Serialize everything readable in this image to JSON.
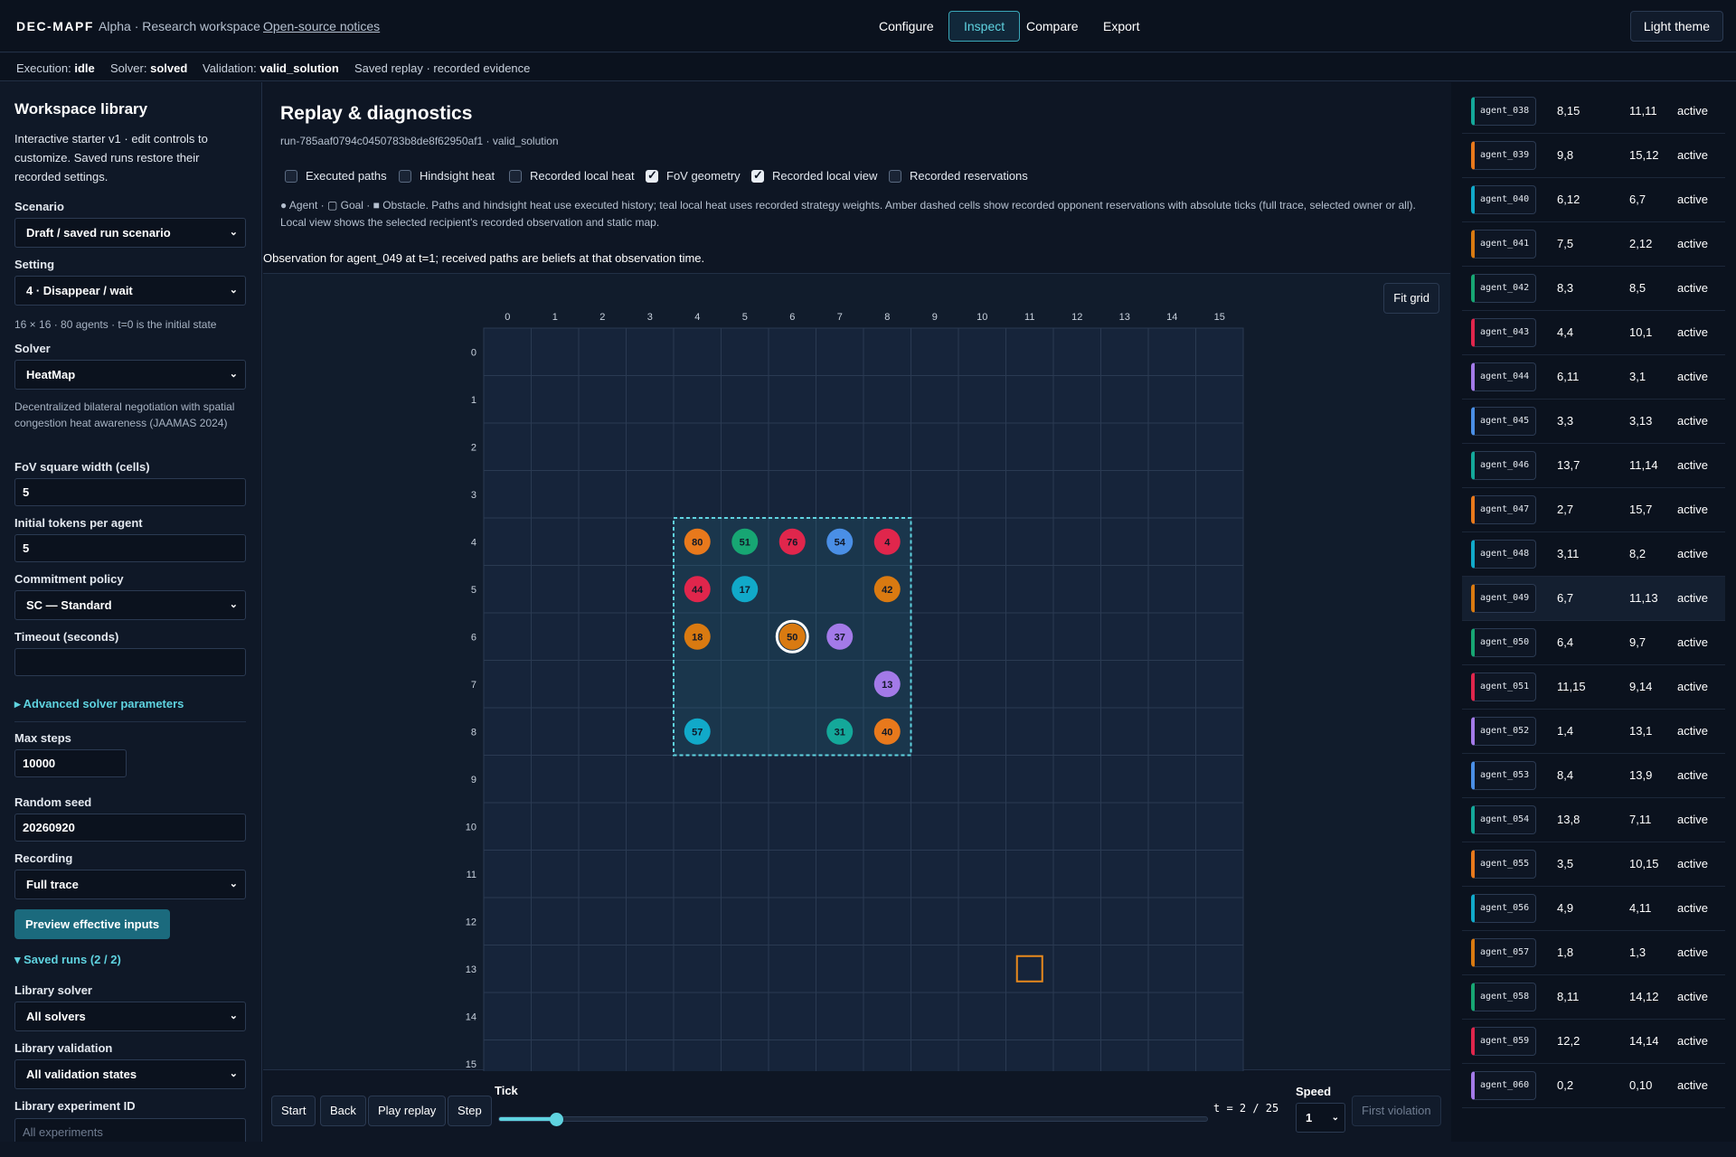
{
  "header": {
    "brand": "DEC-MAPF",
    "workspace": "Alpha · Research workspace",
    "notices_link": "Open-source notices",
    "nav": [
      {
        "label": "Configure"
      },
      {
        "label": "Inspect"
      },
      {
        "label": "Compare"
      },
      {
        "label": "Export"
      }
    ],
    "active_nav": "Inspect",
    "theme_button": "Light theme"
  },
  "status": {
    "execution_label": "Execution:",
    "execution_value": "idle",
    "solver_label": "Solver:",
    "solver_value": "solved",
    "validation_label": "Validation:",
    "validation_value": "valid_solution",
    "replay_note": "Saved replay · recorded evidence"
  },
  "sidebar": {
    "title": "Workspace library",
    "description": "Interactive starter v1 · edit controls to customize. Saved runs restore their recorded settings.",
    "scenario_label": "Scenario",
    "scenario_value": "Draft / saved run scenario",
    "setting_label": "Setting",
    "setting_value": "4 · Disappear / wait",
    "setting_hint": "16 × 16 · 80 agents · t=0 is the initial state",
    "solver_label": "Solver",
    "solver_value": "HeatMap",
    "solver_hint": "Decentralized bilateral negotiation with spatial congestion heat awareness (JAAMAS 2024)",
    "fov_label": "FoV square width (cells)",
    "fov_value": "5",
    "tokens_label": "Initial tokens per agent",
    "tokens_value": "5",
    "commitment_label": "Commitment policy",
    "commitment_value": "SC — Standard",
    "timeout_label": "Timeout (seconds)",
    "timeout_value": "",
    "advanced_label": "Advanced solver parameters",
    "max_steps_label": "Max steps",
    "max_steps_value": "10000",
    "seed_label": "Random seed",
    "seed_value": "20260920",
    "recording_label": "Recording",
    "recording_value": "Full trace",
    "preview_button": "Preview effective inputs",
    "saved_runs_label": "Saved runs (2 / 2)",
    "library_solver_label": "Library solver",
    "library_solver_value": "All solvers",
    "library_validation_label": "Library validation",
    "library_validation_value": "All validation states",
    "library_experiment_label": "Library experiment ID",
    "library_experiment_placeholder": "All experiments"
  },
  "main": {
    "title": "Replay & diagnostics",
    "run_id": "run-785aaf0794c0450783b8de8f62950af1 · valid_solution",
    "toggles": [
      {
        "label": "Executed paths",
        "checked": false
      },
      {
        "label": "Hindsight heat",
        "checked": false
      },
      {
        "label": "Recorded local heat",
        "checked": false
      },
      {
        "label": "FoV geometry",
        "checked": true
      },
      {
        "label": "Recorded local view",
        "checked": true
      },
      {
        "label": "Recorded reservations",
        "checked": false
      }
    ],
    "legend": "● Agent · ▢ Goal · ■ Obstacle. Paths and hindsight heat use executed history; teal local heat uses recorded strategy weights. Amber dashed cells show recorded opponent reservations with absolute ticks (full trace, selected owner or all). Local view shows the selected recipient's recorded observation and static map.",
    "observation": "Observation for agent_049 at t=1; received paths are beliefs at that observation time.",
    "fit_button": "Fit grid"
  },
  "grid": {
    "cols": 16,
    "rows": 16,
    "fov": {
      "col_start": 4,
      "row_start": 4,
      "size": 5
    },
    "selected_agent": "50",
    "agents": [
      {
        "id": "80",
        "x": 4,
        "y": 4,
        "color": "#e8791c"
      },
      {
        "id": "51",
        "x": 5,
        "y": 4,
        "color": "#17a673"
      },
      {
        "id": "76",
        "x": 6,
        "y": 4,
        "color": "#e0264c"
      },
      {
        "id": "54",
        "x": 7,
        "y": 4,
        "color": "#4a8fe6"
      },
      {
        "id": "4",
        "x": 8,
        "y": 4,
        "color": "#e0264c"
      },
      {
        "id": "44",
        "x": 4,
        "y": 5,
        "color": "#e0264c"
      },
      {
        "id": "17",
        "x": 5,
        "y": 5,
        "color": "#11a9c9"
      },
      {
        "id": "42",
        "x": 8,
        "y": 5,
        "color": "#d97a11"
      },
      {
        "id": "18",
        "x": 4,
        "y": 6,
        "color": "#d97a11"
      },
      {
        "id": "50",
        "x": 6,
        "y": 6,
        "color": "#d97a11"
      },
      {
        "id": "37",
        "x": 7,
        "y": 6,
        "color": "#a37ae8"
      },
      {
        "id": "13",
        "x": 8,
        "y": 7,
        "color": "#a37ae8"
      },
      {
        "id": "57",
        "x": 4,
        "y": 8,
        "color": "#11a9c9"
      },
      {
        "id": "31",
        "x": 7,
        "y": 8,
        "color": "#14a89a"
      },
      {
        "id": "40",
        "x": 8,
        "y": 8,
        "color": "#e8791c"
      }
    ],
    "goal": {
      "x": 11,
      "y": 13,
      "color": "#e8891c"
    }
  },
  "playback": {
    "start": "Start",
    "back": "Back",
    "play": "Play replay",
    "step": "Step",
    "tick_label": "Tick",
    "tick_readout": "t = 2 / 25",
    "tick": 2,
    "tick_max": 25,
    "speed_label": "Speed",
    "speed_value": "1",
    "first_violation": "First violation"
  },
  "agent_table": [
    {
      "name": "agent_038",
      "pos": "8,15",
      "goal": "11,11",
      "status": "active",
      "color": "#14a89a"
    },
    {
      "name": "agent_039",
      "pos": "9,8",
      "goal": "15,12",
      "status": "active",
      "color": "#e8791c"
    },
    {
      "name": "agent_040",
      "pos": "6,12",
      "goal": "6,7",
      "status": "active",
      "color": "#11a9c9"
    },
    {
      "name": "agent_041",
      "pos": "7,5",
      "goal": "2,12",
      "status": "active",
      "color": "#d97a11"
    },
    {
      "name": "agent_042",
      "pos": "8,3",
      "goal": "8,5",
      "status": "active",
      "color": "#17a673"
    },
    {
      "name": "agent_043",
      "pos": "4,4",
      "goal": "10,1",
      "status": "active",
      "color": "#e0264c"
    },
    {
      "name": "agent_044",
      "pos": "6,11",
      "goal": "3,1",
      "status": "active",
      "color": "#a37ae8"
    },
    {
      "name": "agent_045",
      "pos": "3,3",
      "goal": "3,13",
      "status": "active",
      "color": "#4a8fe6"
    },
    {
      "name": "agent_046",
      "pos": "13,7",
      "goal": "11,14",
      "status": "active",
      "color": "#14a89a"
    },
    {
      "name": "agent_047",
      "pos": "2,7",
      "goal": "15,7",
      "status": "active",
      "color": "#e8791c"
    },
    {
      "name": "agent_048",
      "pos": "3,11",
      "goal": "8,2",
      "status": "active",
      "color": "#11a9c9"
    },
    {
      "name": "agent_049",
      "pos": "6,7",
      "goal": "11,13",
      "status": "active",
      "color": "#d97a11"
    },
    {
      "name": "agent_050",
      "pos": "6,4",
      "goal": "9,7",
      "status": "active",
      "color": "#17a673"
    },
    {
      "name": "agent_051",
      "pos": "11,15",
      "goal": "9,14",
      "status": "active",
      "color": "#e0264c"
    },
    {
      "name": "agent_052",
      "pos": "1,4",
      "goal": "13,1",
      "status": "active",
      "color": "#a37ae8"
    },
    {
      "name": "agent_053",
      "pos": "8,4",
      "goal": "13,9",
      "status": "active",
      "color": "#4a8fe6"
    },
    {
      "name": "agent_054",
      "pos": "13,8",
      "goal": "7,11",
      "status": "active",
      "color": "#14a89a"
    },
    {
      "name": "agent_055",
      "pos": "3,5",
      "goal": "10,15",
      "status": "active",
      "color": "#e8791c"
    },
    {
      "name": "agent_056",
      "pos": "4,9",
      "goal": "4,11",
      "status": "active",
      "color": "#11a9c9"
    },
    {
      "name": "agent_057",
      "pos": "1,8",
      "goal": "1,3",
      "status": "active",
      "color": "#d97a11"
    },
    {
      "name": "agent_058",
      "pos": "8,11",
      "goal": "14,12",
      "status": "active",
      "color": "#17a673"
    },
    {
      "name": "agent_059",
      "pos": "12,2",
      "goal": "14,14",
      "status": "active",
      "color": "#e0264c"
    },
    {
      "name": "agent_060",
      "pos": "0,2",
      "goal": "0,10",
      "status": "active",
      "color": "#a37ae8"
    }
  ],
  "highlighted_agent": "agent_049"
}
